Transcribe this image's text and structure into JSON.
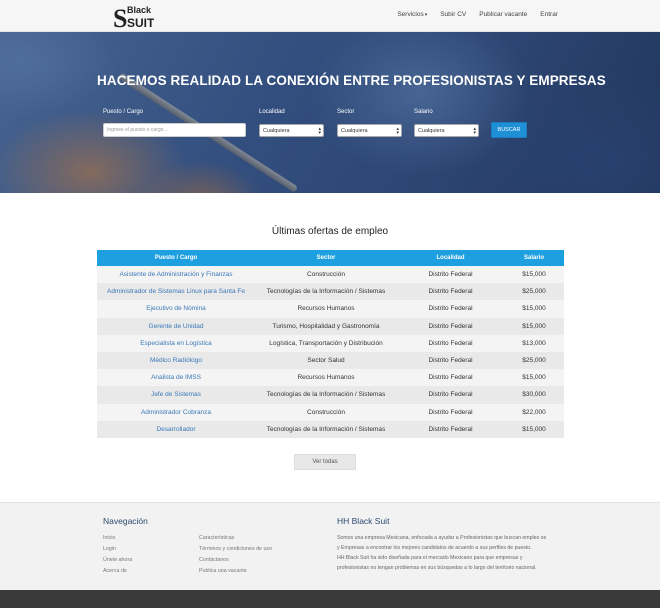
{
  "brand": {
    "logo_line1": "Black",
    "logo_line2": "SUIT",
    "logo_mark": "S"
  },
  "nav": {
    "items": [
      {
        "label": "Servicios",
        "has_caret": true
      },
      {
        "label": "Subir CV"
      },
      {
        "label": "Publicar vacante"
      },
      {
        "label": "Entrar"
      }
    ]
  },
  "hero": {
    "title": "HACEMOS REALIDAD LA CONEXIÓN ENTRE PROFESIONISTAS Y EMPRESAS",
    "search": {
      "puesto_label": "Puesto / Cargo",
      "puesto_placeholder": "Ingrese el puesto o cargo...",
      "localidad_label": "Localidad",
      "localidad_value": "Cualquiera",
      "sector_label": "Sector",
      "sector_value": "Cualquiera",
      "salario_label": "Salario",
      "salario_value": "Cualquiera",
      "button_label": "BUSCAR"
    }
  },
  "jobs": {
    "title": "Últimas ofertas de empleo",
    "columns": [
      "Puesto / Cargo",
      "Sector",
      "Localidad",
      "Salario"
    ],
    "rows": [
      [
        "Asistente de Administración y Finanzas",
        "Construcción",
        "Distrito Federal",
        "$15,000"
      ],
      [
        "Administrador de Sistemas Linux para Santa Fe",
        "Tecnologías de la Información / Sistemas",
        "Distrito Federal",
        "$25,000"
      ],
      [
        "Ejecutivo de Nómina",
        "Recursos Humanos",
        "Distrito Federal",
        "$15,000"
      ],
      [
        "Gerente de Unidad",
        "Turismo, Hospitalidad y Gastronomía",
        "Distrito Federal",
        "$15,000"
      ],
      [
        "Especialista en Logística",
        "Logística, Transportación y Distribución",
        "Distrito Federal",
        "$13,000"
      ],
      [
        "Médico Radiólogo",
        "Sector Salud",
        "Distrito Federal",
        "$25,000"
      ],
      [
        "Analista de IMSS",
        "Recursos Humanos",
        "Distrito Federal",
        "$15,000"
      ],
      [
        "Jefe de Sistemas",
        "Tecnologías de la Información / Sistemas",
        "Distrito Federal",
        "$30,000"
      ],
      [
        "Administrador Cobranza",
        "Construcción",
        "Distrito Federal",
        "$22,000"
      ],
      [
        "Desarrollador",
        "Tecnologías de la Información / Sistemas",
        "Distrito Federal",
        "$15,000"
      ]
    ],
    "see_all_label": "Ver todas"
  },
  "footer": {
    "nav_title": "Navegación",
    "nav_col1": [
      "Inicio",
      "Login",
      "Únete ahora",
      "Acerca de"
    ],
    "nav_col2": [
      "Características",
      "Términos y condiciones de uso",
      "Contáctanos",
      "Publica una vacante"
    ],
    "about_title": "HH Black Suit",
    "about_lines": [
      "Somos una empresa Mexicana, enfocada a ayudar a Profesionistas que buscan empleo se",
      "y Empresas a encontrar los mejores candidatos de acuerdo a sus perfiles de puesto.",
      "HH Black Suit ha sido diseñada para el mercado Mexicano para que empresas y",
      "profesionistas no tengan problemas en sus búsquedas a lo largo del territorio nacional."
    ]
  },
  "colors": {
    "accent": "#1ea0e0",
    "button": "#1f8fd6",
    "link": "#3a78b8",
    "footer_bg": "#f2f2f2",
    "bottom_bar": "#3a3a3a"
  }
}
